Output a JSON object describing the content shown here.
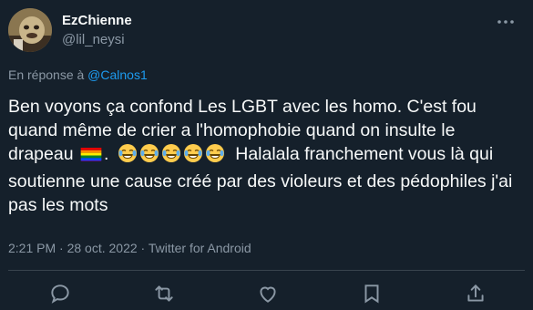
{
  "author": {
    "display_name": "EzChienne",
    "handle": "@lil_neysi",
    "avatar_icon": "avatar-image"
  },
  "reply": {
    "prefix": "En réponse à ",
    "mention": "@Calnos1"
  },
  "tweet": {
    "text_part1": "Ben voyons ça confond Les LGBT avec les homo. C'est fou quand même de crier a l'homophobie quand on insulte le drapeau ",
    "flag_icon": "rainbow-flag-emoji",
    "text_part2": ". ",
    "emoji_icons": [
      "face-with-tears-of-joy",
      "face-with-tears-of-joy",
      "face-with-tears-of-joy",
      "face-with-tears-of-joy",
      "face-with-tears-of-joy"
    ],
    "text_part3": " Halalala franchement vous là qui soutienne une cause créé par des violeurs et des pédophiles j'ai pas les mots"
  },
  "meta": {
    "text": "2:21 PM · 28 oct. 2022 · Twitter for Android"
  },
  "actions": [
    "reply-icon",
    "retweet-icon",
    "like-icon",
    "bookmark-icon",
    "share-icon"
  ],
  "colors": {
    "background": "#15202b",
    "text": "#f7f9f9",
    "muted": "#8b98a5",
    "link": "#1d9bf0",
    "divider": "#38444d"
  }
}
